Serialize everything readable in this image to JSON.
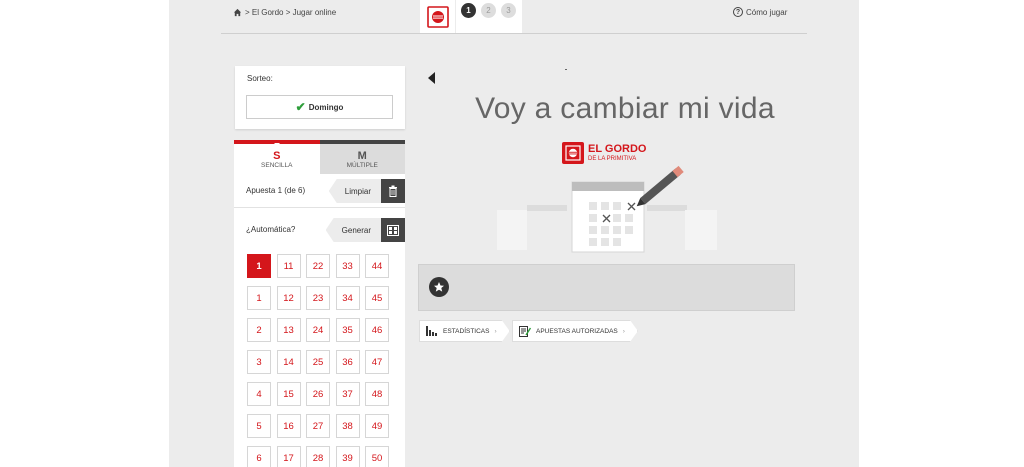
{
  "breadcrumb": {
    "text": "> El Gordo > Jugar online"
  },
  "steps": [
    {
      "label": "1"
    },
    {
      "label": "2"
    },
    {
      "label": "3"
    }
  ],
  "help": {
    "label": "Cómo jugar"
  },
  "sorteo": {
    "label": "Sorteo:",
    "selected": "Domingo"
  },
  "tabs": [
    {
      "letter": "S",
      "label": "SENCILLA",
      "active": true
    },
    {
      "letter": "M",
      "label": "MÚLTIPLE",
      "active": false
    }
  ],
  "apuesta": {
    "label": "Apuesta 1 (de 6)",
    "action": "Limpiar"
  },
  "automatica": {
    "label": "¿Automática?",
    "action": "Generar"
  },
  "numbers": {
    "rows": [
      [
        "1",
        "11",
        "22",
        "33",
        "44"
      ],
      [
        "1",
        "12",
        "23",
        "34",
        "45"
      ],
      [
        "2",
        "13",
        "24",
        "35",
        "46"
      ],
      [
        "3",
        "14",
        "25",
        "36",
        "47"
      ],
      [
        "4",
        "15",
        "26",
        "37",
        "48"
      ],
      [
        "5",
        "16",
        "27",
        "38",
        "49"
      ],
      [
        "6",
        "17",
        "28",
        "39",
        "50"
      ]
    ],
    "selected": [
      "1"
    ]
  },
  "headline": "Voy a cambiar mi vida",
  "brand": {
    "line1": "EL GORDO",
    "line2": "DE LA PRIMITIVA"
  },
  "links": {
    "stats": "ESTADÍSTICAS",
    "authorized": "APUESTAS AUTORIZADAS",
    "chevron": "›"
  },
  "colors": {
    "accent": "#d4161b",
    "dark": "#333333",
    "panel_bg": "#ececec"
  }
}
